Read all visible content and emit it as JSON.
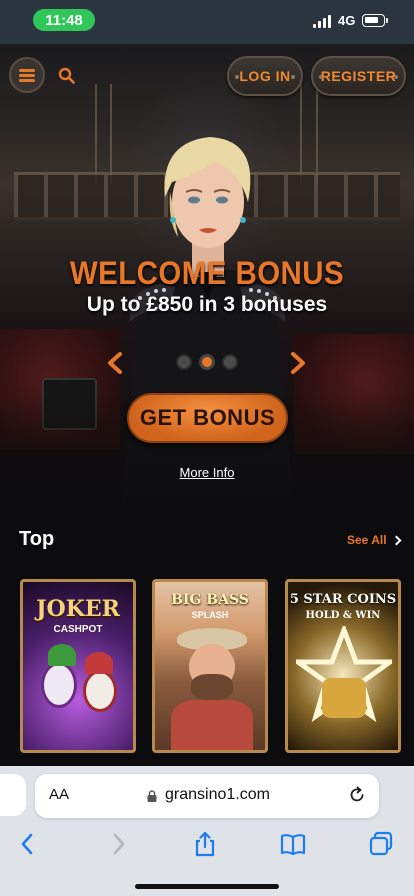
{
  "status_bar": {
    "time": "11:48",
    "network": "4G"
  },
  "header": {
    "login_label": "LOG IN",
    "register_label": "REGISTER"
  },
  "hero": {
    "title": "WELCOME BONUS",
    "subtitle": "Up to £850 in 3 bonuses",
    "cta_label": "GET BONUS",
    "more_info": "More Info",
    "carousel": {
      "slides": 3,
      "active": 2
    }
  },
  "top_section": {
    "title": "Top",
    "see_all": "See All",
    "games": [
      {
        "title": "JOKER",
        "subtitle": "CASHPOT"
      },
      {
        "title": "BIG BASS",
        "subtitle": "SPLASH"
      },
      {
        "title": "5 STAR COINS",
        "subtitle": "HOLD & WIN"
      }
    ]
  },
  "browser": {
    "aa_label": "AA",
    "url": "gransino1.com"
  },
  "colors": {
    "accent": "#e8772a",
    "status_pill": "#30c75a",
    "ios_blue": "#1e7cf2"
  }
}
